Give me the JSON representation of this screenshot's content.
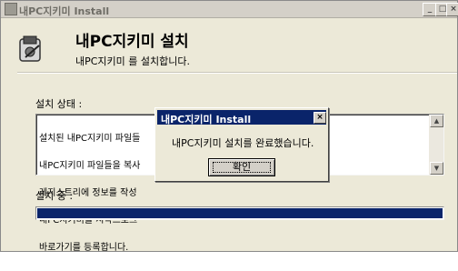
{
  "window": {
    "title": "내PC지키미 Install",
    "min_glyph": "_",
    "max_glyph": "□",
    "close_glyph": "×"
  },
  "installer": {
    "heading": "내PC지키미 설치",
    "subheading": "내PC지키미 를 설치합니다.",
    "status_label": "설치 상태 :",
    "log_lines": [
      "설치된 내PC지키미 파일들",
      "내PC지키미 파일들을 복사",
      "레지스트리에 정보를 작성",
      "내PC지키미를 시작프로그",
      "바로가기를 등록합니다."
    ],
    "progress_label": "설치 중 :",
    "progress_fraction": 1.0
  },
  "dialog": {
    "title": "내PC지키미 Install",
    "close_glyph": "×",
    "message": "내PC지키미 설치를 완료했습니다.",
    "ok_label": "확인"
  },
  "icons": {
    "app": "installer-app-icon",
    "main": "installer-disk-icon"
  },
  "colors": {
    "title_active": "#0a246a",
    "progress": "#0a246a",
    "face": "#ece9d8"
  }
}
